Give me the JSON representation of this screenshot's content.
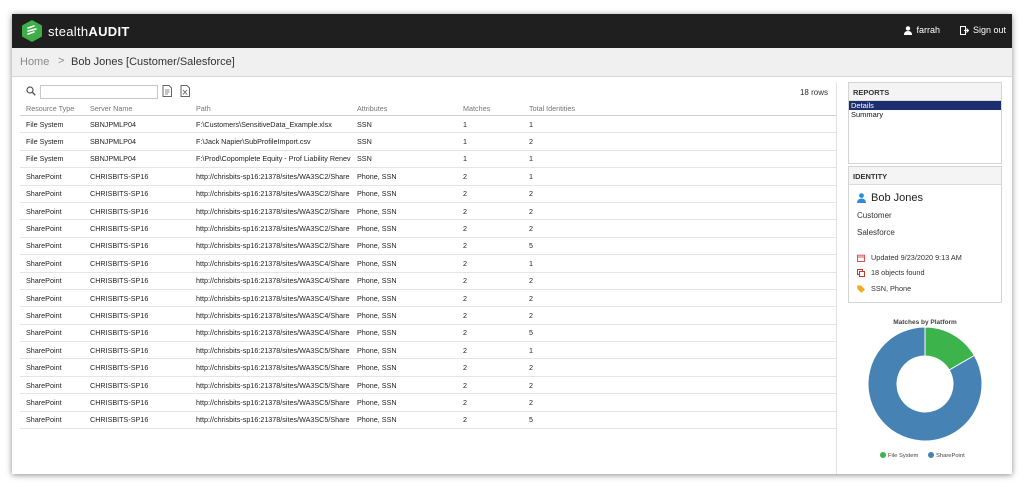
{
  "app": {
    "brand_light": "stealth",
    "brand_bold": "AUDIT"
  },
  "header": {
    "user": "farrah",
    "signout": "Sign out"
  },
  "breadcrumb": {
    "home": "Home",
    "separator": ">",
    "current": "Bob Jones [Customer/Salesforce]"
  },
  "toolbar": {
    "search_placeholder": "",
    "row_count": "18 rows"
  },
  "table": {
    "columns": [
      "Resource Type",
      "Server Name",
      "Path",
      "Attributes",
      "Matches",
      "Total Identities"
    ],
    "rows": [
      [
        "File System",
        "SBNJPMLP04",
        "F:\\Customers\\SensitiveData_Example.xlsx",
        "SSN",
        "1",
        "1"
      ],
      [
        "File System",
        "SBNJPMLP04",
        "F:\\Jack Napier\\SubProfileImport.csv",
        "SSN",
        "1",
        "2"
      ],
      [
        "File System",
        "SBNJPMLP04",
        "F:\\Prod\\Copomplete Equity - Prof Liability Renev",
        "SSN",
        "1",
        "1"
      ],
      [
        "SharePoint",
        "CHRISBITS-SP16",
        "http://chrisbits-sp16:21378/sites/WA3SC2/Share",
        "Phone, SSN",
        "2",
        "1"
      ],
      [
        "SharePoint",
        "CHRISBITS-SP16",
        "http://chrisbits-sp16:21378/sites/WA3SC2/Share",
        "Phone, SSN",
        "2",
        "2"
      ],
      [
        "SharePoint",
        "CHRISBITS-SP16",
        "http://chrisbits-sp16:21378/sites/WA3SC2/Share",
        "Phone, SSN",
        "2",
        "2"
      ],
      [
        "SharePoint",
        "CHRISBITS-SP16",
        "http://chrisbits-sp16:21378/sites/WA3SC2/Share",
        "Phone, SSN",
        "2",
        "2"
      ],
      [
        "SharePoint",
        "CHRISBITS-SP16",
        "http://chrisbits-sp16:21378/sites/WA3SC2/Share",
        "Phone, SSN",
        "2",
        "5"
      ],
      [
        "SharePoint",
        "CHRISBITS-SP16",
        "http://chrisbits-sp16:21378/sites/WA3SC4/Share",
        "Phone, SSN",
        "2",
        "1"
      ],
      [
        "SharePoint",
        "CHRISBITS-SP16",
        "http://chrisbits-sp16:21378/sites/WA3SC4/Share",
        "Phone, SSN",
        "2",
        "2"
      ],
      [
        "SharePoint",
        "CHRISBITS-SP16",
        "http://chrisbits-sp16:21378/sites/WA3SC4/Share",
        "Phone, SSN",
        "2",
        "2"
      ],
      [
        "SharePoint",
        "CHRISBITS-SP16",
        "http://chrisbits-sp16:21378/sites/WA3SC4/Share",
        "Phone, SSN",
        "2",
        "2"
      ],
      [
        "SharePoint",
        "CHRISBITS-SP16",
        "http://chrisbits-sp16:21378/sites/WA3SC4/Share",
        "Phone, SSN",
        "2",
        "5"
      ],
      [
        "SharePoint",
        "CHRISBITS-SP16",
        "http://chrisbits-sp16:21378/sites/WA3SC5/Share",
        "Phone, SSN",
        "2",
        "1"
      ],
      [
        "SharePoint",
        "CHRISBITS-SP16",
        "http://chrisbits-sp16:21378/sites/WA3SC5/Share",
        "Phone, SSN",
        "2",
        "2"
      ],
      [
        "SharePoint",
        "CHRISBITS-SP16",
        "http://chrisbits-sp16:21378/sites/WA3SC5/Share",
        "Phone, SSN",
        "2",
        "2"
      ],
      [
        "SharePoint",
        "CHRISBITS-SP16",
        "http://chrisbits-sp16:21378/sites/WA3SC5/Share",
        "Phone, SSN",
        "2",
        "2"
      ],
      [
        "SharePoint",
        "CHRISBITS-SP16",
        "http://chrisbits-sp16:21378/sites/WA3SC5/Share",
        "Phone, SSN",
        "2",
        "5"
      ]
    ]
  },
  "reports": {
    "title": "REPORTS",
    "items": [
      "Details",
      "Summary"
    ],
    "active_index": 0
  },
  "identity": {
    "title": "IDENTITY",
    "name": "Bob Jones",
    "line1": "Customer",
    "line2": "Salesforce",
    "updated": "Updated 9/23/2020 9:13 AM",
    "objects": "18 objects found",
    "attributes": "SSN, Phone"
  },
  "icons": {
    "search": "search-icon",
    "export_pdf": "export-pdf-icon",
    "export_excel": "export-excel-icon",
    "user": "user-icon",
    "signout": "sign-out-icon",
    "calendar": "calendar-icon",
    "copy": "copy-icon",
    "tag": "tag-icon"
  },
  "colors": {
    "topbar": "#1e1f1e",
    "brand_green": "#3fae49",
    "active_report": "#1c2e6e",
    "file_system": "#3cb44b",
    "sharepoint": "#4682b4"
  },
  "chart_data": {
    "type": "pie",
    "title": "Matches by Platform",
    "donut": true,
    "categories": [
      "File System",
      "SharePoint"
    ],
    "values": [
      3,
      15
    ],
    "colors": [
      "#3cb44b",
      "#4682b4"
    ],
    "legend": "bottom"
  }
}
